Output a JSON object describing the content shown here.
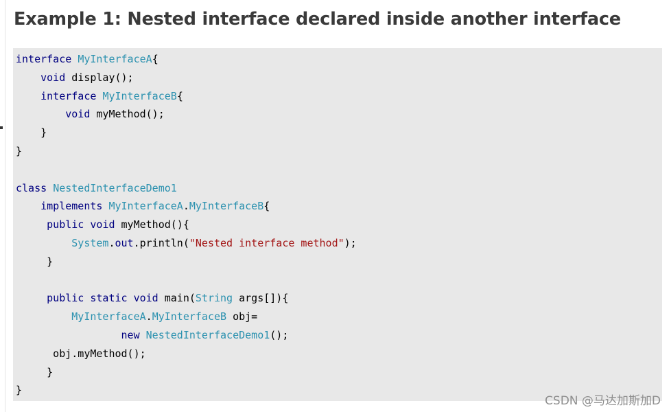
{
  "title": "Example 1: Nested interface declared inside another interface",
  "code_lines": [
    [
      {
        "t": "kw",
        "s": "interface "
      },
      {
        "t": "ty",
        "s": "MyInterfaceA"
      },
      {
        "t": "pl",
        "s": "{"
      }
    ],
    [
      {
        "t": "pl",
        "s": "    "
      },
      {
        "t": "kw",
        "s": "void "
      },
      {
        "t": "pl",
        "s": "display();"
      }
    ],
    [
      {
        "t": "pl",
        "s": "    "
      },
      {
        "t": "kw",
        "s": "interface "
      },
      {
        "t": "ty",
        "s": "MyInterfaceB"
      },
      {
        "t": "pl",
        "s": "{"
      }
    ],
    [
      {
        "t": "pl",
        "s": "        "
      },
      {
        "t": "kw",
        "s": "void "
      },
      {
        "t": "pl",
        "s": "myMethod();"
      }
    ],
    [
      {
        "t": "pl",
        "s": "    }"
      }
    ],
    [
      {
        "t": "pl",
        "s": "}"
      }
    ],
    [
      {
        "t": "pl",
        "s": ""
      }
    ],
    [
      {
        "t": "kw",
        "s": "class "
      },
      {
        "t": "ty",
        "s": "NestedInterfaceDemo1"
      }
    ],
    [
      {
        "t": "pl",
        "s": "    "
      },
      {
        "t": "kw",
        "s": "implements "
      },
      {
        "t": "ty",
        "s": "MyInterfaceA"
      },
      {
        "t": "pl",
        "s": "."
      },
      {
        "t": "ty",
        "s": "MyInterfaceB"
      },
      {
        "t": "pl",
        "s": "{"
      }
    ],
    [
      {
        "t": "pl",
        "s": "     "
      },
      {
        "t": "kw",
        "s": "public void "
      },
      {
        "t": "pl",
        "s": "myMethod(){"
      }
    ],
    [
      {
        "t": "pl",
        "s": "         "
      },
      {
        "t": "ty",
        "s": "System"
      },
      {
        "t": "pl",
        "s": "."
      },
      {
        "t": "kw",
        "s": "out"
      },
      {
        "t": "pl",
        "s": ".println("
      },
      {
        "t": "st",
        "s": "\"Nested interface method\""
      },
      {
        "t": "pl",
        "s": ");"
      }
    ],
    [
      {
        "t": "pl",
        "s": "     }"
      }
    ],
    [
      {
        "t": "pl",
        "s": ""
      }
    ],
    [
      {
        "t": "pl",
        "s": "     "
      },
      {
        "t": "kw",
        "s": "public static void "
      },
      {
        "t": "pl",
        "s": "main("
      },
      {
        "t": "ty",
        "s": "String"
      },
      {
        "t": "pl",
        "s": " args[]){"
      }
    ],
    [
      {
        "t": "pl",
        "s": "         "
      },
      {
        "t": "ty",
        "s": "MyInterfaceA"
      },
      {
        "t": "pl",
        "s": "."
      },
      {
        "t": "ty",
        "s": "MyInterfaceB"
      },
      {
        "t": "pl",
        "s": " obj="
      }
    ],
    [
      {
        "t": "pl",
        "s": "                 "
      },
      {
        "t": "kw",
        "s": "new "
      },
      {
        "t": "ty",
        "s": "NestedInterfaceDemo1"
      },
      {
        "t": "pl",
        "s": "();"
      }
    ],
    [
      {
        "t": "pl",
        "s": "      obj.myMethod();"
      }
    ],
    [
      {
        "t": "pl",
        "s": "     }"
      }
    ],
    [
      {
        "t": "pl",
        "s": "}"
      }
    ]
  ],
  "watermark": "CSDN @马达加斯加D"
}
